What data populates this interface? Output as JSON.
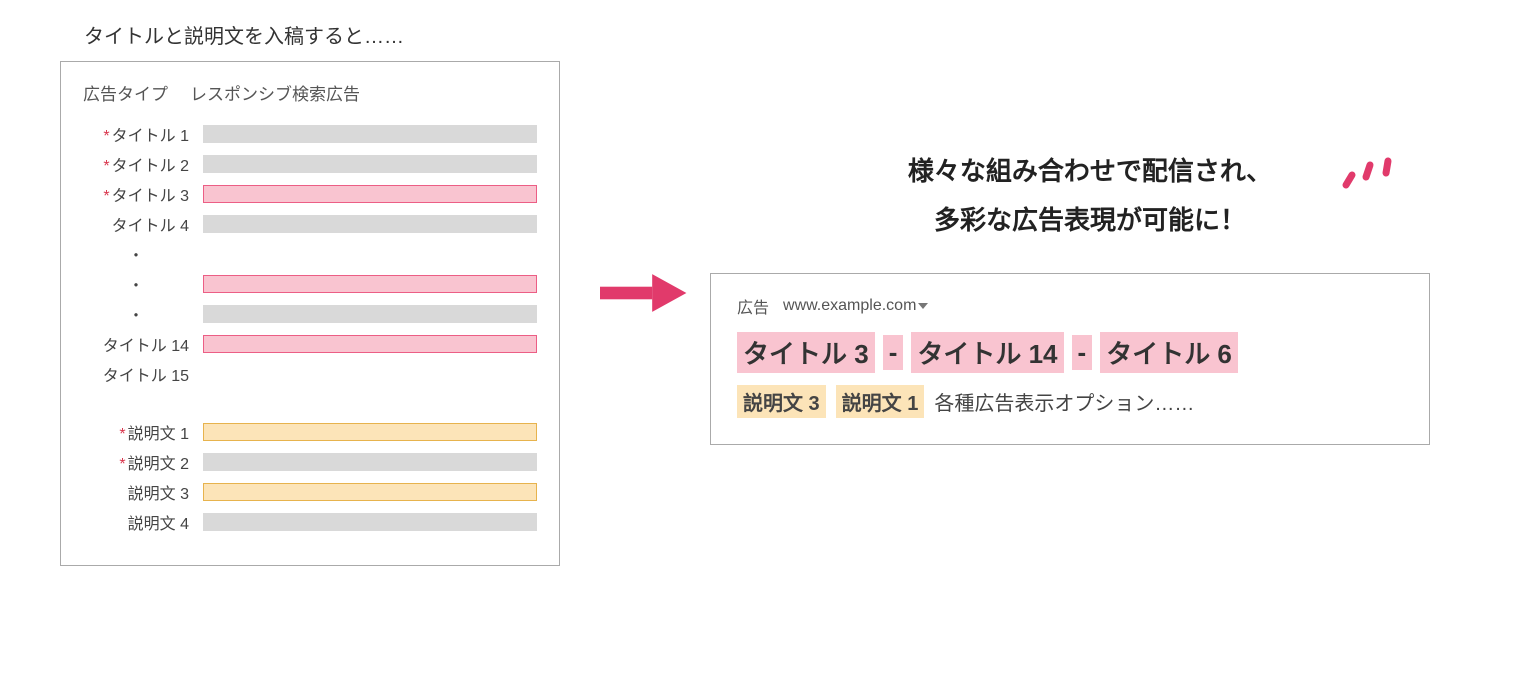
{
  "left": {
    "heading": "タイトルと説明文を入稿すると……",
    "ad_type_label": "広告タイプ",
    "ad_type_value": "レスポンシブ検索広告",
    "titles": [
      {
        "label": "タイトル 1",
        "required": true,
        "color": "gray"
      },
      {
        "label": "タイトル 2",
        "required": true,
        "color": "gray"
      },
      {
        "label": "タイトル 3",
        "required": true,
        "color": "pink"
      },
      {
        "label": "タイトル 4",
        "required": false,
        "color": "gray"
      }
    ],
    "mid_bars": [
      {
        "color": "pink"
      },
      {
        "color": "gray"
      }
    ],
    "titles_end": [
      {
        "label": "タイトル 14",
        "required": false,
        "color": "pink"
      },
      {
        "label": "タイトル 15",
        "required": false,
        "color": "none"
      }
    ],
    "descs": [
      {
        "label": "説明文 1",
        "required": true,
        "color": "orange"
      },
      {
        "label": "説明文 2",
        "required": true,
        "color": "gray"
      },
      {
        "label": "説明文 3",
        "required": false,
        "color": "orange"
      },
      {
        "label": "説明文 4",
        "required": false,
        "color": "gray"
      }
    ],
    "asterisk": "*",
    "dot": "・"
  },
  "right": {
    "headline_l1": "様々な組み合わせで配信され、",
    "headline_l2": "多彩な広告表現が可能に！",
    "ad_badge": "広告",
    "ad_url": "www.example.com",
    "sep": " - ",
    "title_parts": [
      "タイトル 3",
      "タイトル 14",
      "タイトル 6"
    ],
    "desc_parts": [
      "説明文 3",
      "説明文 1"
    ],
    "options_text": "各種広告表示オプション……"
  },
  "colors": {
    "arrow": "#e13a6b",
    "spark": "#e13a6b"
  }
}
